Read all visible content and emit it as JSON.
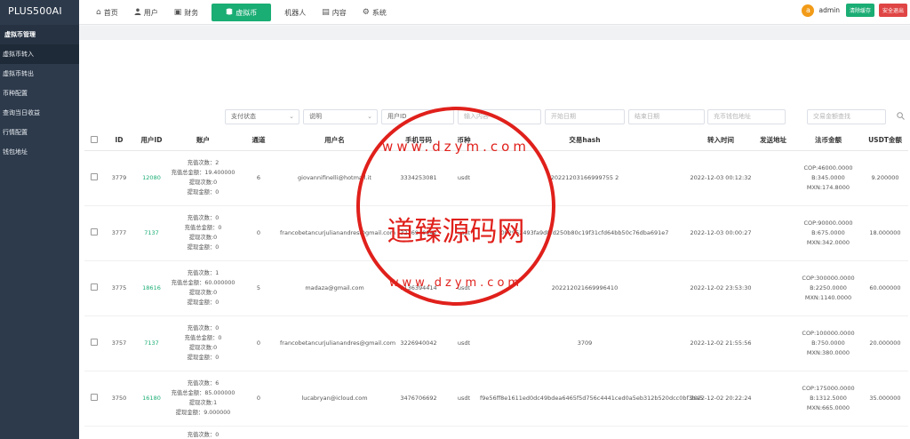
{
  "brand": "PLUS500AI",
  "sidebar": {
    "group": "虚拟币管理",
    "items": [
      {
        "label": "虚拟币转入",
        "active": true
      },
      {
        "label": "虚拟币转出",
        "active": false
      },
      {
        "label": "币种配置",
        "active": false
      },
      {
        "label": "查询当日收益",
        "active": false
      },
      {
        "label": "行情配置",
        "active": false
      },
      {
        "label": "钱包地址",
        "active": false
      }
    ]
  },
  "nav": [
    {
      "icon": "home-icon",
      "glyph": "⌂",
      "label": "首页"
    },
    {
      "icon": "user-icon",
      "glyph": "👤",
      "label": "用户"
    },
    {
      "icon": "finance-icon",
      "glyph": "▣",
      "label": "财务"
    },
    {
      "icon": "coin-icon",
      "glyph": "◉",
      "label": "虚拟币",
      "active": true
    },
    {
      "icon": "",
      "glyph": "",
      "label": "机器人"
    },
    {
      "icon": "content-icon",
      "glyph": "▤",
      "label": "内容"
    },
    {
      "icon": "gear-icon",
      "glyph": "⚙",
      "label": "系统"
    }
  ],
  "header": {
    "avatar_letter": "a",
    "admin_name": "admin",
    "clear_cache": "清除缓存",
    "logout": "安全退出"
  },
  "filters": {
    "pay_status": "支付状态",
    "description": "说明",
    "user_id": "用户ID",
    "keyword_placeholder": "输入内容",
    "start_date_placeholder": "开始日期",
    "end_date_placeholder": "结束日期",
    "wallet_placeholder": "充币钱包地址",
    "fiat_search_placeholder": "交易金额查找"
  },
  "table": {
    "headers": [
      "ID",
      "用户ID",
      "账户",
      "通道",
      "用户名",
      "手机号码",
      "币种",
      "交易hash",
      "转入时间",
      "发送地址",
      "法币金额",
      "USDT金额"
    ],
    "rows": [
      {
        "id": "3779",
        "user_id": "12080",
        "account": [
          "充值次数：2",
          "充值总金额：19.400000",
          "提现次数:0",
          "提现金额：0"
        ],
        "channel": "6",
        "username": "giovannifinelli@hotmail.it",
        "phone": "3334253081",
        "coin": "usdt",
        "hash": "20221203166999755 2",
        "time": "2022-12-03 00:12:32",
        "send_addr": "",
        "fiat": [
          "COP:46000.0000",
          "B:345.0000",
          "MXN:174.8000"
        ],
        "usdt": "9.200000"
      },
      {
        "id": "3777",
        "user_id": "7137",
        "account": [
          "充值次数：0",
          "充值总金额：0",
          "提现次数:0",
          "提现金额：0"
        ],
        "channel": "0",
        "username": "francobetancurjulianandres@gmail.com",
        "phone": "3226940042",
        "coin": "usdt",
        "hash": "002952493fa9d8fd250b80c19f31cfd64bb50c76dba691e7",
        "time": "2022-12-03 00:00:27",
        "send_addr": "",
        "fiat": [
          "COP:90000.0000",
          "B:675.0000",
          "MXN:342.0000"
        ],
        "usdt": "18.000000"
      },
      {
        "id": "3775",
        "user_id": "18616",
        "account": [
          "充值次数：1",
          "充值总金额：60.000000",
          "提现次数:0",
          "提现金额：0"
        ],
        "channel": "5",
        "username": "madaza@gmail.com",
        "phone": "3136394414",
        "coin": "usdt",
        "hash": "202212021669996410",
        "time": "2022-12-02 23:53:30",
        "send_addr": "",
        "fiat": [
          "COP:300000.0000",
          "B:2250.0000",
          "MXN:1140.0000"
        ],
        "usdt": "60.000000"
      },
      {
        "id": "3757",
        "user_id": "7137",
        "account": [
          "充值次数：0",
          "充值总金额：0",
          "提现次数:0",
          "提现金额：0"
        ],
        "channel": "0",
        "username": "francobetancurjulianandres@gmail.com",
        "phone": "3226940042",
        "coin": "usdt",
        "hash": "3709",
        "time": "2022-12-02 21:55:56",
        "send_addr": "",
        "fiat": [
          "COP:100000.0000",
          "B:750.0000",
          "MXN:380.0000"
        ],
        "usdt": "20.000000"
      },
      {
        "id": "3750",
        "user_id": "16180",
        "account": [
          "充值次数：6",
          "充值总金额：85.000000",
          "提现次数:1",
          "提现金额：9.000000"
        ],
        "channel": "0",
        "username": "lucabryan@icloud.com",
        "phone": "3476706692",
        "coin": "usdt",
        "hash": "f9e56ff8e1611ed0dc49bdea6465f5d756c4441ced0a5eb312b520dcc0bf3ba5",
        "time": "2022-12-02 20:22:24",
        "send_addr": "",
        "fiat": [
          "COP:175000.0000",
          "B:1312.5000",
          "MXN:665.0000"
        ],
        "usdt": "35.000000"
      }
    ],
    "partial_row_first_line": "充值次数：0"
  },
  "watermark": {
    "center_text": "道臻源码网",
    "top_text": "www.dzym.com",
    "bottom_text": "www.dzym.com",
    "color": "#e0201b"
  },
  "colors": {
    "sidebar_bg": "#2d3a4b",
    "accent_green": "#1aad74",
    "logout_red": "#e04545",
    "avatar_orange": "#f29b18"
  }
}
